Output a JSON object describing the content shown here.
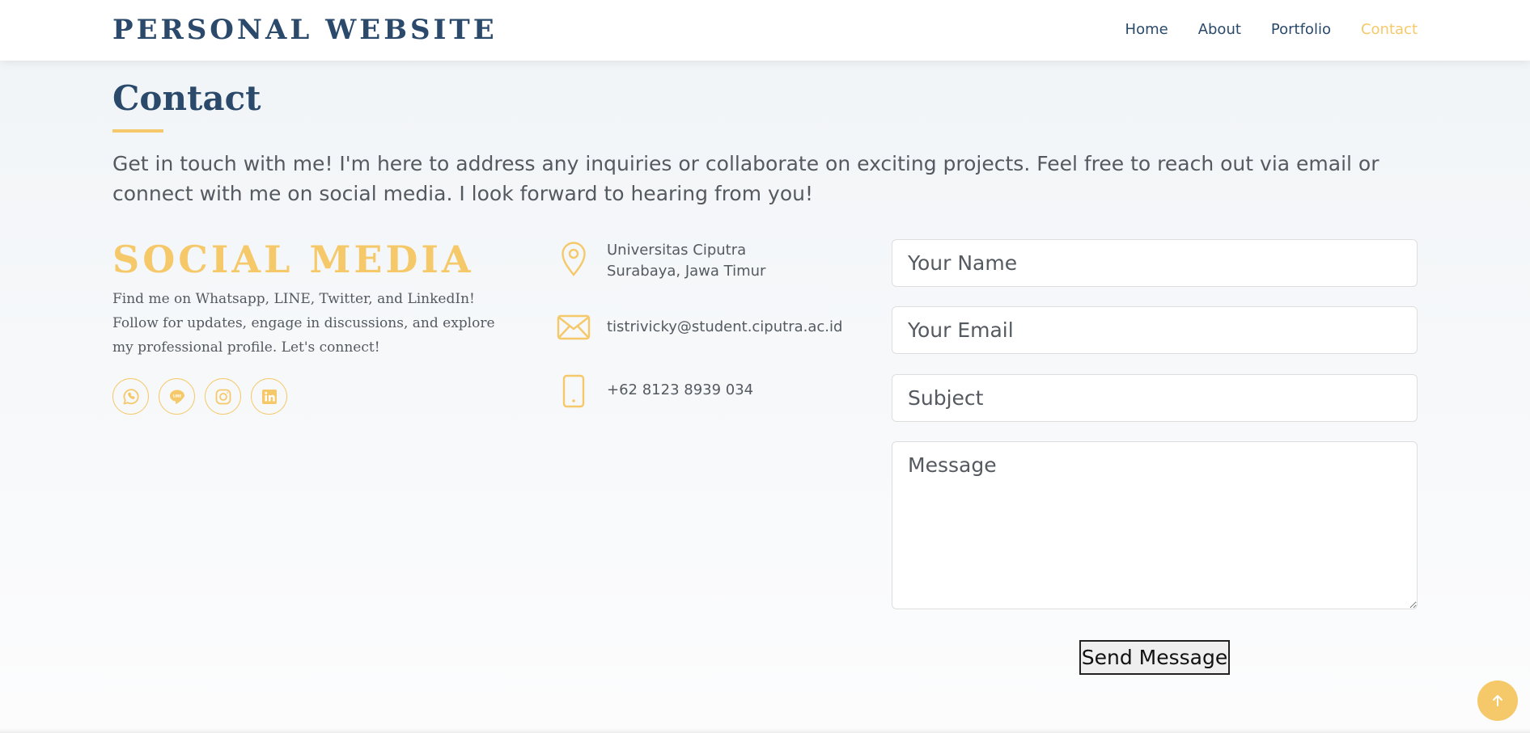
{
  "navbar": {
    "brand": "PERSONAL WEBSITE",
    "links": [
      {
        "label": "Home",
        "active": false
      },
      {
        "label": "About",
        "active": false
      },
      {
        "label": "Portfolio",
        "active": false
      },
      {
        "label": "Contact",
        "active": true
      }
    ]
  },
  "contact": {
    "title": "Contact",
    "intro": "Get in touch with me! I'm here to address any inquiries or collaborate on exciting projects. Feel free to reach out via email or connect with me on social media. I look forward to hearing from you!"
  },
  "social": {
    "title": "SOCIAL MEDIA",
    "text": "Find me on Whatsapp, LINE, Twitter, and LinkedIn! Follow for updates, engage in discussions, and explore my professional profile. Let's connect!",
    "icons": [
      "whatsapp-icon",
      "line-icon",
      "instagram-icon",
      "linkedin-icon"
    ]
  },
  "info": {
    "address_line1": "Universitas Ciputra",
    "address_line2": "Surabaya, Jawa Timur",
    "email": "tistrivicky@student.ciputra.ac.id",
    "phone": "+62 8123 8939 034"
  },
  "form": {
    "name_placeholder": "Your Name",
    "email_placeholder": "Your Email",
    "subject_placeholder": "Subject",
    "message_placeholder": "Message",
    "submit_label": "Send Message"
  },
  "colors": {
    "accent": "#f5c96a",
    "primary": "#2b4a6b",
    "text": "#555a60"
  }
}
